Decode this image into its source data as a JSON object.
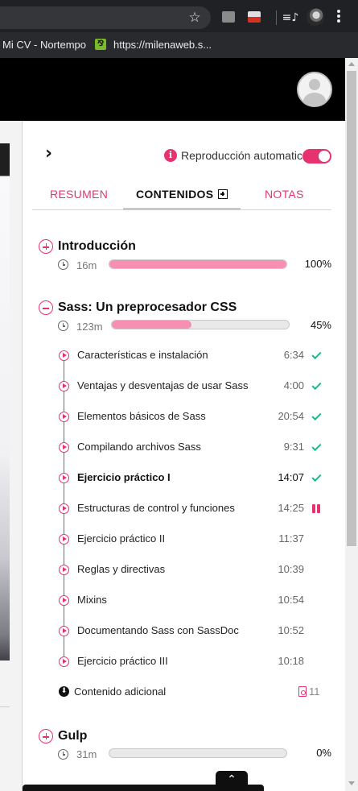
{
  "browser": {
    "bookmarks": [
      {
        "label": "Mi CV - Nortempo"
      },
      {
        "label": "https://milenaweb.s..."
      }
    ],
    "icons": {
      "star": "☆",
      "extensions": [
        "extension-icon",
        "extension-icon"
      ],
      "media": "≡♪",
      "menu": "kebab-menu-icon"
    }
  },
  "course_panel": {
    "autoplay_label": "Reproducción automatica",
    "info_symbol": "i",
    "autoplay_enabled": true,
    "tabs": [
      {
        "label": "RESUMEN"
      },
      {
        "label": "CONTENIDOS"
      },
      {
        "label": "NOTAS"
      }
    ],
    "sections": [
      {
        "title": "Introducción",
        "duration": "16m",
        "progress": 100,
        "percent_label": "100%",
        "expanded": false
      },
      {
        "title": "Sass: Un preprocesador CSS",
        "duration": "123m",
        "progress": 45,
        "percent_label": "45%",
        "expanded": true,
        "lessons": [
          {
            "title": "Características e instalación",
            "time": "6:34",
            "status": "completed"
          },
          {
            "title": "Ventajas y desventajas de usar Sass",
            "time": "4:00",
            "status": "completed"
          },
          {
            "title": "Elementos básicos de Sass",
            "time": "20:54",
            "status": "completed"
          },
          {
            "title": "Compilando archivos Sass",
            "time": "9:31",
            "status": "completed"
          },
          {
            "title": "Ejercicio práctico I",
            "time": "14:07",
            "status": "completed",
            "current": true
          },
          {
            "title": "Estructuras de control y funciones",
            "time": "14:25",
            "status": "in-progress"
          },
          {
            "title": "Ejercicio práctico II",
            "time": "11:37",
            "status": "pending"
          },
          {
            "title": "Reglas y directivas",
            "time": "10:39",
            "status": "pending"
          },
          {
            "title": "Mixins",
            "time": "10:54",
            "status": "pending"
          },
          {
            "title": "Documentando Sass con SassDoc",
            "time": "10:52",
            "status": "pending"
          },
          {
            "title": "Ejercicio práctico III",
            "time": "10:18",
            "status": "pending"
          }
        ],
        "extra": {
          "label": "Contenido adicional",
          "count": "11"
        }
      },
      {
        "title": "Gulp",
        "duration": "31m",
        "progress": 0,
        "percent_label": "0%",
        "expanded": false
      }
    ]
  },
  "colors": {
    "accent": "#e6336f",
    "progress_fill": "#f78fb3",
    "check": "#1fb58f"
  }
}
